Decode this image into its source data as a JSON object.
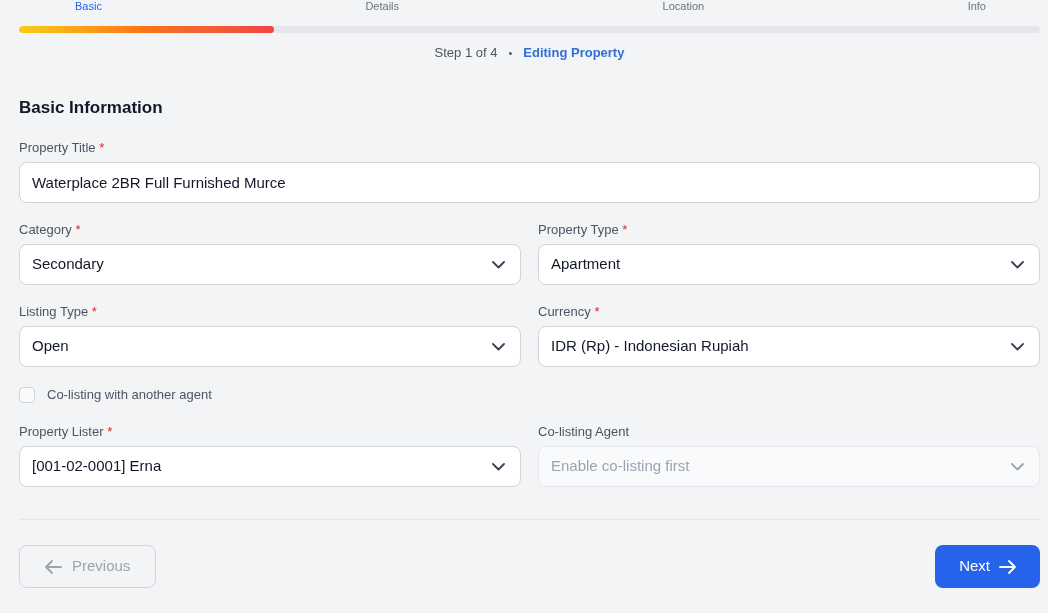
{
  "steps": [
    {
      "label": "Basic",
      "selected": true
    },
    {
      "label": "Details",
      "selected": false
    },
    {
      "label": "Location",
      "selected": false
    },
    {
      "label": "Info",
      "selected": false
    }
  ],
  "progress": {
    "level": 0.25
  },
  "status": {
    "step": "Step 1 of 4",
    "separator": "•",
    "mode": "Editing Property"
  },
  "section_title": "Basic Information",
  "rows": [
    {
      "fields": [
        {
          "kind": "text",
          "label": "Property Title",
          "required_mark": "*",
          "value": "Waterplace 2BR Full Furnished Murce",
          "disabled": false
        }
      ]
    },
    {
      "fields": [
        {
          "kind": "select",
          "label": "Category",
          "required_mark": "*",
          "value": "Secondary",
          "disabled": false
        },
        {
          "kind": "select",
          "label": "Property Type",
          "required_mark": "*",
          "value": "Apartment",
          "disabled": false
        }
      ]
    },
    {
      "fields": [
        {
          "kind": "select",
          "label": "Listing Type",
          "required_mark": "*",
          "value": "Open",
          "disabled": false
        },
        {
          "kind": "select",
          "label": "Currency",
          "required_mark": "*",
          "value": "IDR (Rp) - Indonesian Rupiah",
          "disabled": false
        }
      ]
    },
    {
      "fields": [
        {
          "kind": "checkbox",
          "label": "Co-listing with another agent",
          "checked": false
        }
      ]
    },
    {
      "fields": [
        {
          "kind": "select",
          "label": "Property Lister",
          "required_mark": "*",
          "value": "[001-02-0001] Erna",
          "disabled": false
        },
        {
          "kind": "select",
          "label": "Co-listing Agent",
          "placeholder": "Enable co-listing first",
          "disabled": true
        }
      ]
    }
  ],
  "buttons": [
    {
      "kind": "back",
      "label": "Previous",
      "disabled": true
    },
    {
      "kind": "next",
      "label": "Next",
      "disabled": false
    }
  ]
}
